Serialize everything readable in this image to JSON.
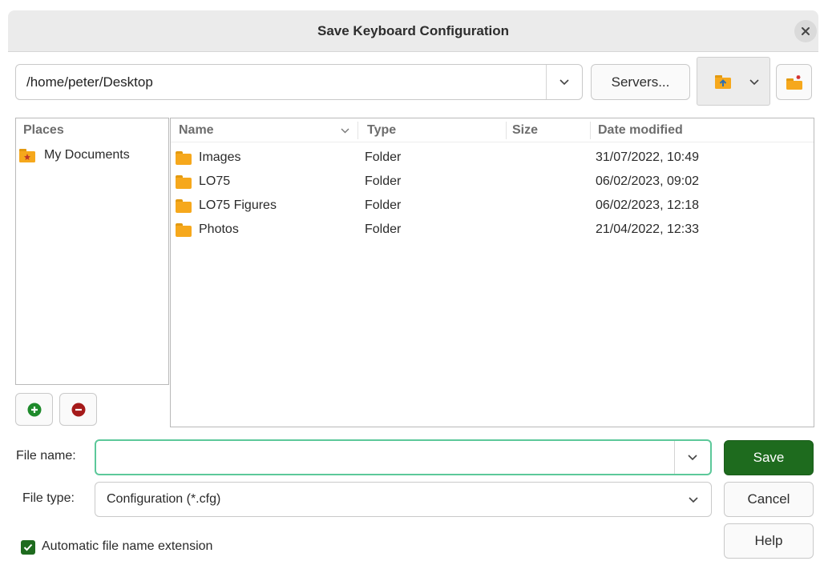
{
  "dialog": {
    "title": "Save Keyboard Configuration"
  },
  "toolbar": {
    "path": "/home/peter/Desktop",
    "servers_label": "Servers..."
  },
  "places": {
    "header": "Places",
    "items": [
      {
        "label": "My Documents"
      }
    ]
  },
  "files": {
    "columns": {
      "name": "Name",
      "type": "Type",
      "size": "Size",
      "date": "Date modified"
    },
    "rows": [
      {
        "name": "Images",
        "type": "Folder",
        "size": "",
        "date": "31/07/2022, 10:49"
      },
      {
        "name": "LO75",
        "type": "Folder",
        "size": "",
        "date": "06/02/2023, 09:02"
      },
      {
        "name": "LO75 Figures",
        "type": "Folder",
        "size": "",
        "date": "06/02/2023, 12:18"
      },
      {
        "name": "Photos",
        "type": "Folder",
        "size": "",
        "date": "21/04/2022, 12:33"
      }
    ]
  },
  "form": {
    "file_name_label": "File name:",
    "file_name_value": "",
    "file_type_label": "File type:",
    "file_type_value": "Configuration (*.cfg)",
    "auto_ext_label": "Automatic file name extension",
    "auto_ext_checked": true
  },
  "buttons": {
    "save": "Save",
    "cancel": "Cancel",
    "help": "Help"
  },
  "colors": {
    "accent_green": "#1e6b1e",
    "focus_border": "#5cc89a",
    "folder_orange": "#f6a81c",
    "remove_red": "#a51a1a"
  }
}
